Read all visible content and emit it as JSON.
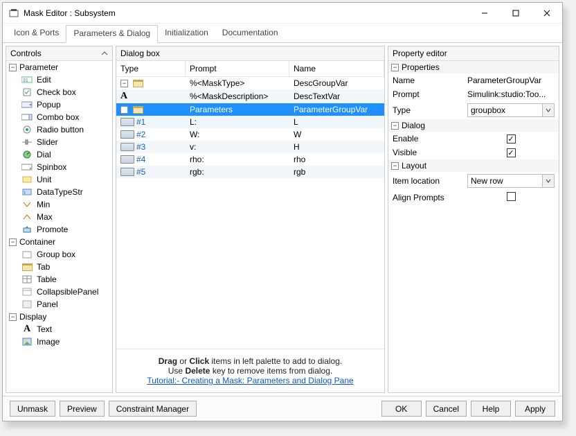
{
  "window": {
    "title": "Mask Editor : Subsystem"
  },
  "tabs": [
    "Icon & Ports",
    "Parameters & Dialog",
    "Initialization",
    "Documentation"
  ],
  "active_tab": 1,
  "panels": {
    "controls": "Controls",
    "dialog": "Dialog box",
    "property": "Property editor"
  },
  "controls": {
    "groups": [
      {
        "label": "Parameter",
        "items": [
          {
            "icon": "edit-icon",
            "label": "Edit"
          },
          {
            "icon": "checkbox-icon",
            "label": "Check box"
          },
          {
            "icon": "popup-icon",
            "label": "Popup"
          },
          {
            "icon": "combobox-icon",
            "label": "Combo box"
          },
          {
            "icon": "radio-icon",
            "label": "Radio button"
          },
          {
            "icon": "slider-icon",
            "label": "Slider"
          },
          {
            "icon": "dial-icon",
            "label": "Dial"
          },
          {
            "icon": "spinbox-icon",
            "label": "Spinbox"
          },
          {
            "icon": "unit-icon",
            "label": "Unit"
          },
          {
            "icon": "datatypestr-icon",
            "label": "DataTypeStr"
          },
          {
            "icon": "min-icon",
            "label": "Min"
          },
          {
            "icon": "max-icon",
            "label": "Max"
          },
          {
            "icon": "promote-icon",
            "label": "Promote"
          }
        ]
      },
      {
        "label": "Container",
        "items": [
          {
            "icon": "groupbox-icon",
            "label": "Group box"
          },
          {
            "icon": "tab-icon",
            "label": "Tab"
          },
          {
            "icon": "table-icon",
            "label": "Table"
          },
          {
            "icon": "collapsiblepanel-icon",
            "label": "CollapsiblePanel"
          },
          {
            "icon": "panel-icon",
            "label": "Panel"
          }
        ]
      },
      {
        "label": "Display",
        "items": [
          {
            "icon": "text-icon",
            "label": "Text"
          },
          {
            "icon": "image-icon",
            "label": "Image"
          }
        ]
      }
    ]
  },
  "dialog_table": {
    "headers": {
      "type": "Type",
      "prompt": "Prompt",
      "name": "Name"
    },
    "rows": [
      {
        "depth": 0,
        "icon": "folder",
        "num": "",
        "prompt": "%<MaskType>",
        "name": "DescGroupVar",
        "selected": false
      },
      {
        "depth": 1,
        "icon": "A",
        "num": "",
        "prompt": "%<MaskDescription>",
        "name": "DescTextVar",
        "selected": false
      },
      {
        "depth": 0,
        "icon": "folder-open",
        "num": "",
        "prompt": "Parameters",
        "name": "ParameterGroupVar",
        "selected": true
      },
      {
        "depth": 2,
        "icon": "edit",
        "num": "#1",
        "prompt": "L:",
        "name": "L",
        "selected": false
      },
      {
        "depth": 2,
        "icon": "edit",
        "num": "#2",
        "prompt": "W:",
        "name": "W",
        "selected": false
      },
      {
        "depth": 2,
        "icon": "edit",
        "num": "#3",
        "prompt": "v:",
        "name": "H",
        "selected": false
      },
      {
        "depth": 2,
        "icon": "edit",
        "num": "#4",
        "prompt": "rho:",
        "name": "rho",
        "selected": false
      },
      {
        "depth": 2,
        "icon": "edit",
        "num": "#5",
        "prompt": "rgb:",
        "name": "rgb",
        "selected": false
      }
    ]
  },
  "hint": {
    "line1a": "Drag",
    "line1b": " or ",
    "line1c": "Click",
    "line1d": " items in left palette to add to dialog.",
    "line2a": "Use ",
    "line2b": "Delete",
    "line2c": " key to remove items from dialog.",
    "link": "Tutorial:- Creating a Mask: Parameters and Dialog Pane"
  },
  "property": {
    "groups": {
      "properties": "Properties",
      "dialog": "Dialog",
      "layout": "Layout"
    },
    "name_label": "Name",
    "name_value": "ParameterGroupVar",
    "prompt_label": "Prompt",
    "prompt_value": "Simulink:studio:Too...",
    "type_label": "Type",
    "type_value": "groupbox",
    "enable_label": "Enable",
    "enable_checked": true,
    "visible_label": "Visible",
    "visible_checked": true,
    "itemloc_label": "Item location",
    "itemloc_value": "New row",
    "align_label": "Align Prompts",
    "align_checked": false
  },
  "footer": {
    "unmask": "Unmask",
    "preview": "Preview",
    "constraint": "Constraint Manager",
    "ok": "OK",
    "cancel": "Cancel",
    "help": "Help",
    "apply": "Apply"
  }
}
